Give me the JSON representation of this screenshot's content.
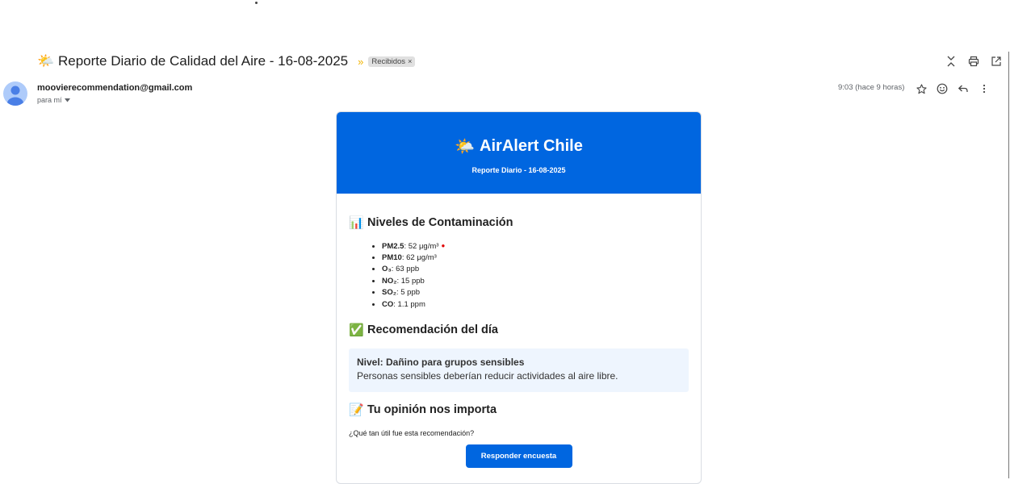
{
  "email": {
    "subject_emoji": "🌤️",
    "subject": "Reporte Diario de Calidad del Aire - 16-08-2025",
    "importance_marker": "»",
    "label": "Recibidos",
    "label_close": "×",
    "sender": "moovierecommendation@gmail.com",
    "to_line": "para mí",
    "time": "9:03 (hace 9 horas)"
  },
  "icons": {
    "collapse": "collapse-icon",
    "print": "print-icon",
    "open_new_window": "open-in-new-icon",
    "star": "star-icon",
    "emoji": "emoji-icon",
    "reply": "reply-icon",
    "more": "more-vert-icon",
    "avatar": "person-icon"
  },
  "report": {
    "brand_emoji": "🌤️",
    "brand": "AirAlert Chile",
    "subtitle": "Reporte Diario - 16-08-2025",
    "levels_icon": "📊",
    "levels_title": "Niveles de Contaminación",
    "pollutants": [
      {
        "name": "PM2.5",
        "sep": ": ",
        "value": "52 μg/m³",
        "alert": "●"
      },
      {
        "name": "PM10",
        "sep": ": ",
        "value": "62 μg/m³"
      },
      {
        "name": "O₃",
        "sep": ": ",
        "value": "63 ppb"
      },
      {
        "name": "NO₂",
        "sep": ": ",
        "value": "15 ppb"
      },
      {
        "name": "SO₂",
        "sep": ": ",
        "value": "5 ppb"
      },
      {
        "name": "CO",
        "sep": ": ",
        "value": "1.1 ppm"
      }
    ],
    "reco_icon": "✅",
    "reco_title": "Recomendación del día",
    "reco_level": "Nivel: Dañino para grupos sensibles",
    "reco_text": "Personas sensibles deberían reducir actividades al aire libre.",
    "opinion_icon": "📝",
    "opinion_title": "Tu opinión nos importa",
    "question": "¿Qué tan útil fue esta recomendación?",
    "cta": "Responder encuesta"
  },
  "colors": {
    "banner": "#0066e0",
    "alert": "#e00000",
    "reco_bg": "#eef5fe"
  }
}
